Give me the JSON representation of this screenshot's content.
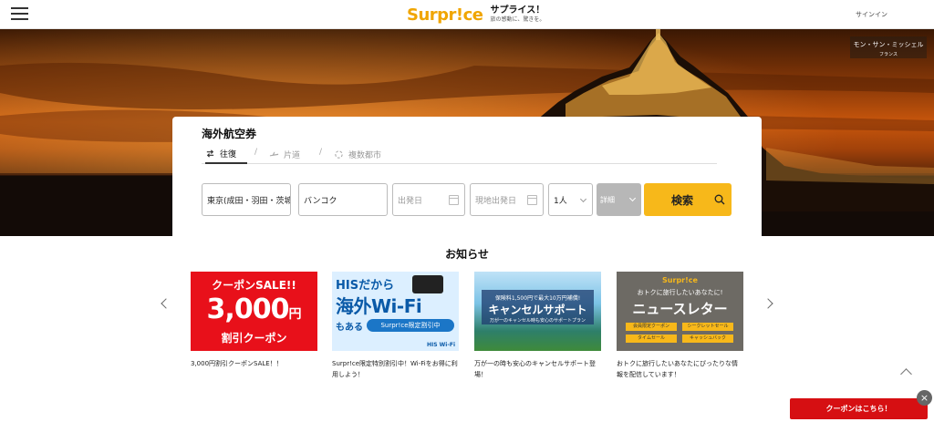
{
  "header": {
    "logo_text": "Surpr!ce",
    "brand_kana": "サプライス！",
    "tagline": "旅の感動に、驚きを。",
    "signin_label": "サインイン"
  },
  "hero": {
    "location_name": "モン・サン・ミッシェル",
    "location_country": "フランス"
  },
  "search": {
    "title": "海外航空券",
    "tabs": [
      {
        "label": "往復",
        "icon": "round-trip-icon",
        "active": true
      },
      {
        "label": "片道",
        "icon": "one-way-plane-icon",
        "active": false
      },
      {
        "label": "複数都市",
        "icon": "multi-city-icon",
        "active": false
      }
    ],
    "tab_separator": "/",
    "origin_value": "東京(成田・羽田・茨城",
    "destination_value": "バンコク",
    "depart_placeholder": "出発日",
    "return_placeholder": "現地出発日",
    "passengers_value": "1人",
    "details_label": "詳細",
    "search_button_label": "検索"
  },
  "news": {
    "title": "お知らせ",
    "cards": [
      {
        "caption": "3,000円割引クーポンSALE！！",
        "banner": {
          "line1": "クーポンSALE!!",
          "amount": "3,000",
          "unit": "円",
          "line3": "割引クーポン"
        }
      },
      {
        "caption": "Surpr!ce限定特別割引中！Wi-Fiをお得に利用しよう！",
        "banner": {
          "line1": "HISだから",
          "line2": "海外Wi-Fi",
          "line3": "もある",
          "pill": "Surpr!ce限定割引中",
          "badge": "HIS Wi-Fi"
        }
      },
      {
        "caption": "万が一の時も安心のキャンセルサポート登場！",
        "banner": {
          "line1": "保険料1,500円で最大10万円補償!",
          "line2": "キャンセルサポート",
          "line3": "万が一のキャンセル時も安心のサポートプラン"
        }
      },
      {
        "caption": "おトクに旅行したいあなたにぴったりな情報を配信しています！",
        "banner": {
          "brand": "Surpr!ce",
          "line1": "おトクに旅行したいあなたに!",
          "line2": "ニュースレター",
          "chips": [
            "会員限定クーポン",
            "シークレットセール",
            "タイムセール",
            "キャッシュバック"
          ]
        }
      }
    ]
  },
  "floating": {
    "coupon_label": "クーポンはこちら！",
    "close_label": "×"
  },
  "colors": {
    "brand_yellow": "#f0a500",
    "search_button": "#f7b81a",
    "coupon_red": "#d60f12",
    "details_gray": "#b7b7b7"
  }
}
